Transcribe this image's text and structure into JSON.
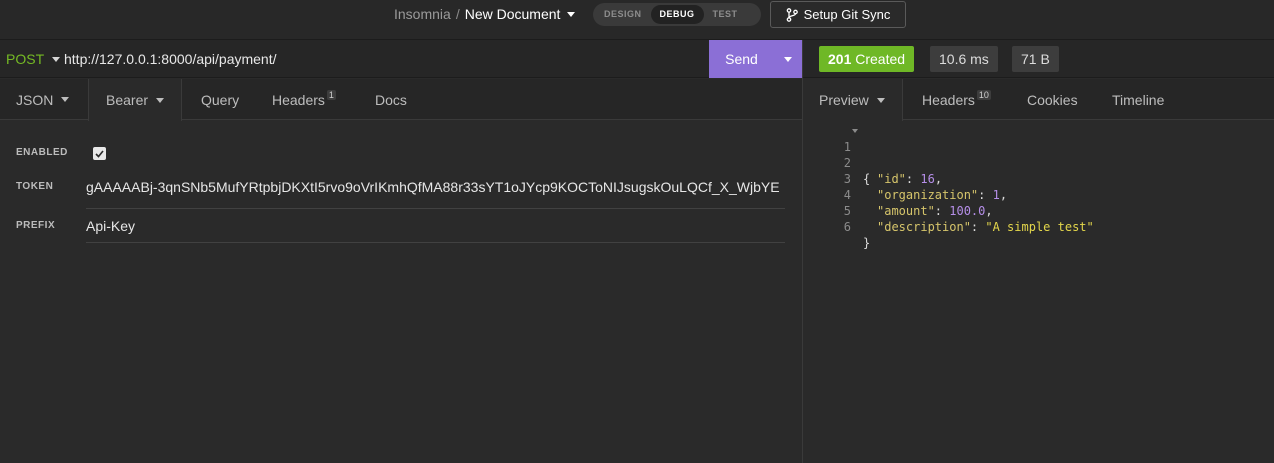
{
  "header": {
    "app_name": "Insomnia",
    "separator": "/",
    "document_name": "New Document",
    "modes": [
      "DESIGN",
      "DEBUG",
      "TEST"
    ],
    "active_mode": "DEBUG",
    "git_sync_label": "Setup Git Sync"
  },
  "request": {
    "method": "POST",
    "url": "http://127.0.0.1:8000/api/payment/",
    "send_label": "Send",
    "tabs": {
      "body": "JSON",
      "auth": "Bearer",
      "query": "Query",
      "headers": "Headers",
      "headers_count": "1",
      "docs": "Docs"
    },
    "auth": {
      "enabled_label": "ENABLED",
      "token_label": "TOKEN",
      "token_value": "gAAAAABj-3qnSNb5MufYRtpbjDKXtI5rvo9oVrIKmhQfMA88r33sYT1oJYcp9KOCToNIJsugskOuLQCf_X_WjbYE",
      "prefix_label": "PREFIX",
      "prefix_value": "Api-Key"
    }
  },
  "response": {
    "status_code": "201",
    "status_text": "Created",
    "time": "10.6 ms",
    "size": "71 B",
    "tabs": {
      "preview": "Preview",
      "headers": "Headers",
      "headers_count": "10",
      "cookies": "Cookies",
      "timeline": "Timeline"
    },
    "body_lines": {
      "l1": "{",
      "l2_key": "\"id\"",
      "l2_val": "16",
      "l3_key": "\"organization\"",
      "l3_val": "1",
      "l4_key": "\"amount\"",
      "l4_val": "100.0",
      "l5_key": "\"description\"",
      "l5_val": "\"A simple test\"",
      "l6": "}"
    },
    "line_numbers": [
      "1",
      "2",
      "3",
      "4",
      "5",
      "6"
    ]
  },
  "colors": {
    "accent": "#8b6fd6",
    "success": "#6fb826",
    "method_post": "#75ba24"
  }
}
